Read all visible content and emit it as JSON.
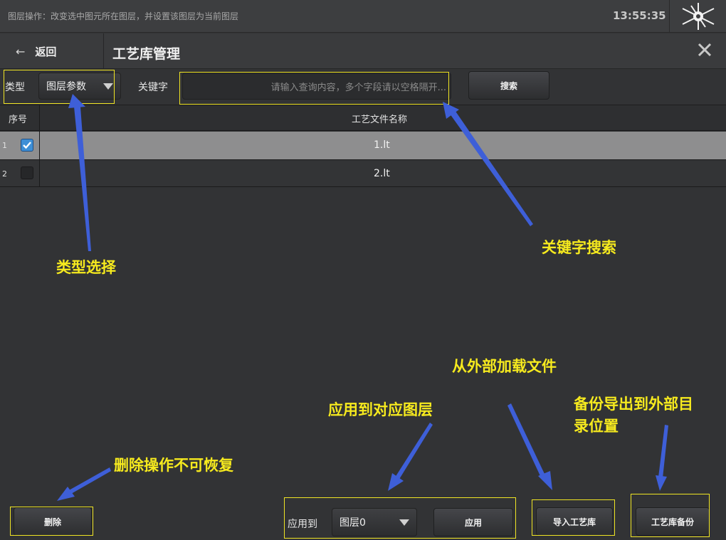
{
  "status": {
    "message": "图层操作：改变选中图元所在图层，并设置该图层为当前图层",
    "time": "13:55:35",
    "logo_icon": "network-node-icon"
  },
  "header": {
    "back_icon": "arrow-left-icon",
    "back_label": "返回",
    "title": "工艺库管理",
    "close_icon": "close-icon"
  },
  "filter": {
    "type_label": "类型",
    "type_value": "图层参数",
    "keyword_label": "关键字",
    "keyword_placeholder": "请输入查询内容，多个字段请以空格隔开...",
    "search_button": "搜索"
  },
  "table": {
    "columns": [
      "序号",
      "工艺文件名称"
    ],
    "rows": [
      {
        "index": "1",
        "checked": true,
        "name": "1.lt"
      },
      {
        "index": "2",
        "checked": false,
        "name": "2.lt"
      }
    ]
  },
  "footer": {
    "delete_button": "删除",
    "apply_to_label": "应用到",
    "layer_value": "图层0",
    "apply_button": "应用",
    "import_button": "导入工艺库",
    "backup_button": "工艺库备份"
  },
  "annotations": {
    "type_select": "类型选择",
    "keyword_search": "关键字搜索",
    "load_external": "从外部加载文件",
    "backup_export_line1": "备份导出到外部目",
    "backup_export_line2": "录位置",
    "apply_layer": "应用到对应图层",
    "delete_warning": "删除操作不可恢复",
    "annotation_color": "#f6ea1e",
    "arrow_color": "#3e5fd8"
  }
}
